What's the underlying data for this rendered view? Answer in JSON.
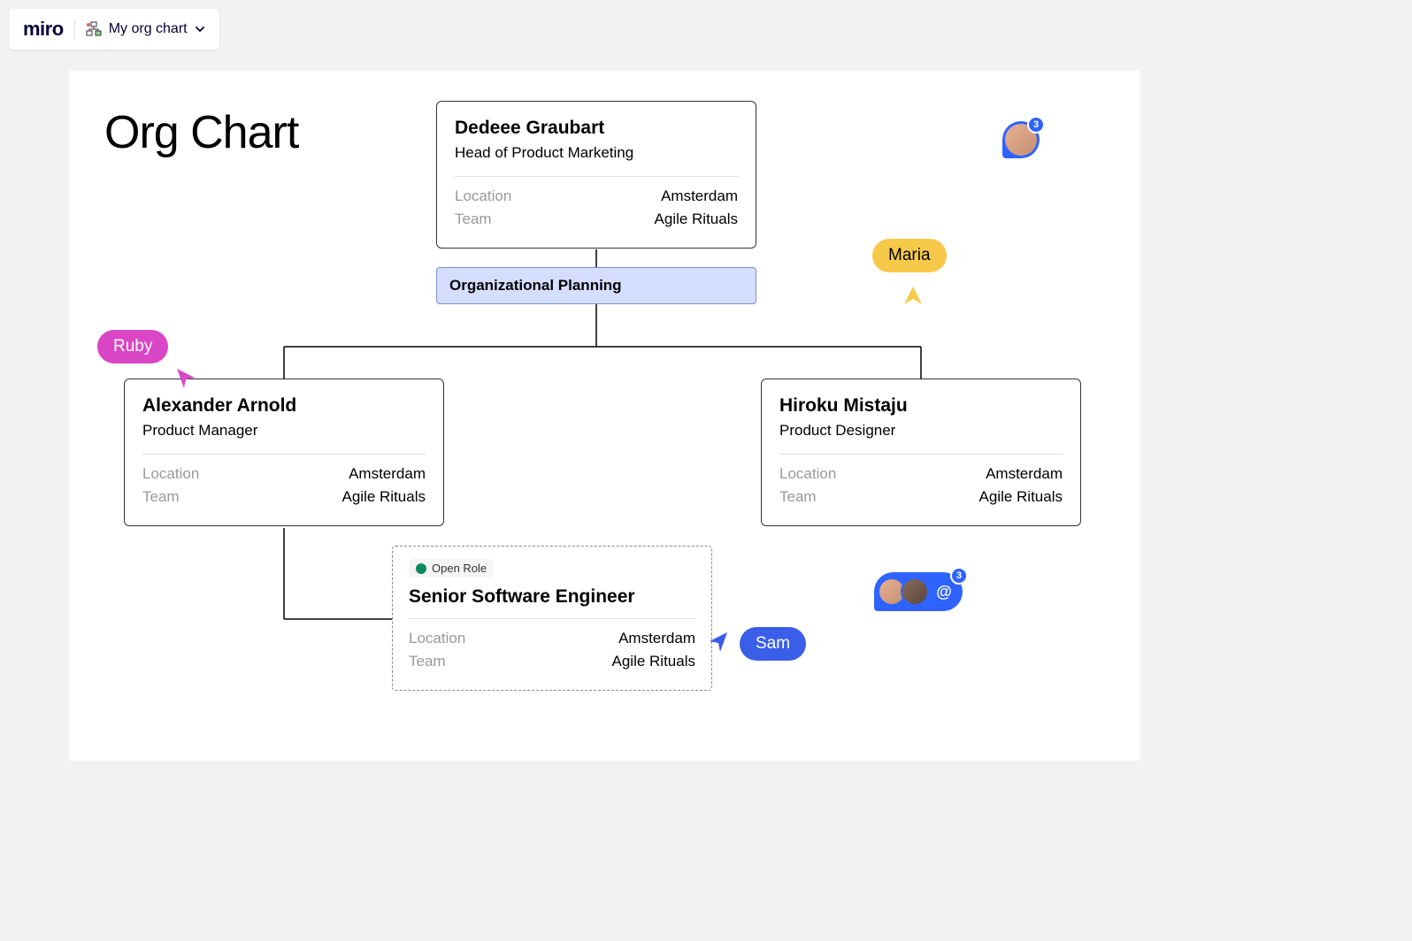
{
  "header": {
    "logo": "miro",
    "board_name": "My org chart"
  },
  "page_title": "Org Chart",
  "banner": "Organizational Planning",
  "cards": {
    "dedeee": {
      "name": "Dedeee Graubart",
      "title": "Head of Product Marketing",
      "location_label": "Location",
      "location_value": "Amsterdam",
      "team_label": "Team",
      "team_value": "Agile Rituals"
    },
    "alexander": {
      "name": "Alexander Arnold",
      "title": "Product Manager",
      "location_label": "Location",
      "location_value": "Amsterdam",
      "team_label": "Team",
      "team_value": "Agile Rituals"
    },
    "hiroku": {
      "name": "Hiroku Mistaju",
      "title": "Product Designer",
      "location_label": "Location",
      "location_value": "Amsterdam",
      "team_label": "Team",
      "team_value": "Agile Rituals"
    },
    "open_role": {
      "badge": "Open Role",
      "title": "Senior Software Engineer",
      "location_label": "Location",
      "location_value": "Amsterdam",
      "team_label": "Team",
      "team_value": "Agile Rituals"
    }
  },
  "cursors": {
    "ruby": "Ruby",
    "maria": "Maria",
    "sam": "Sam"
  },
  "comments": {
    "single_badge": "3",
    "group_badge": "3"
  },
  "colors": {
    "ruby": "#d946c6",
    "maria": "#f7c948",
    "sam": "#3b5ee8",
    "banner_bg": "#d6deff",
    "banner_border": "#7a8dd9",
    "comment_blue": "#2f63ff"
  }
}
